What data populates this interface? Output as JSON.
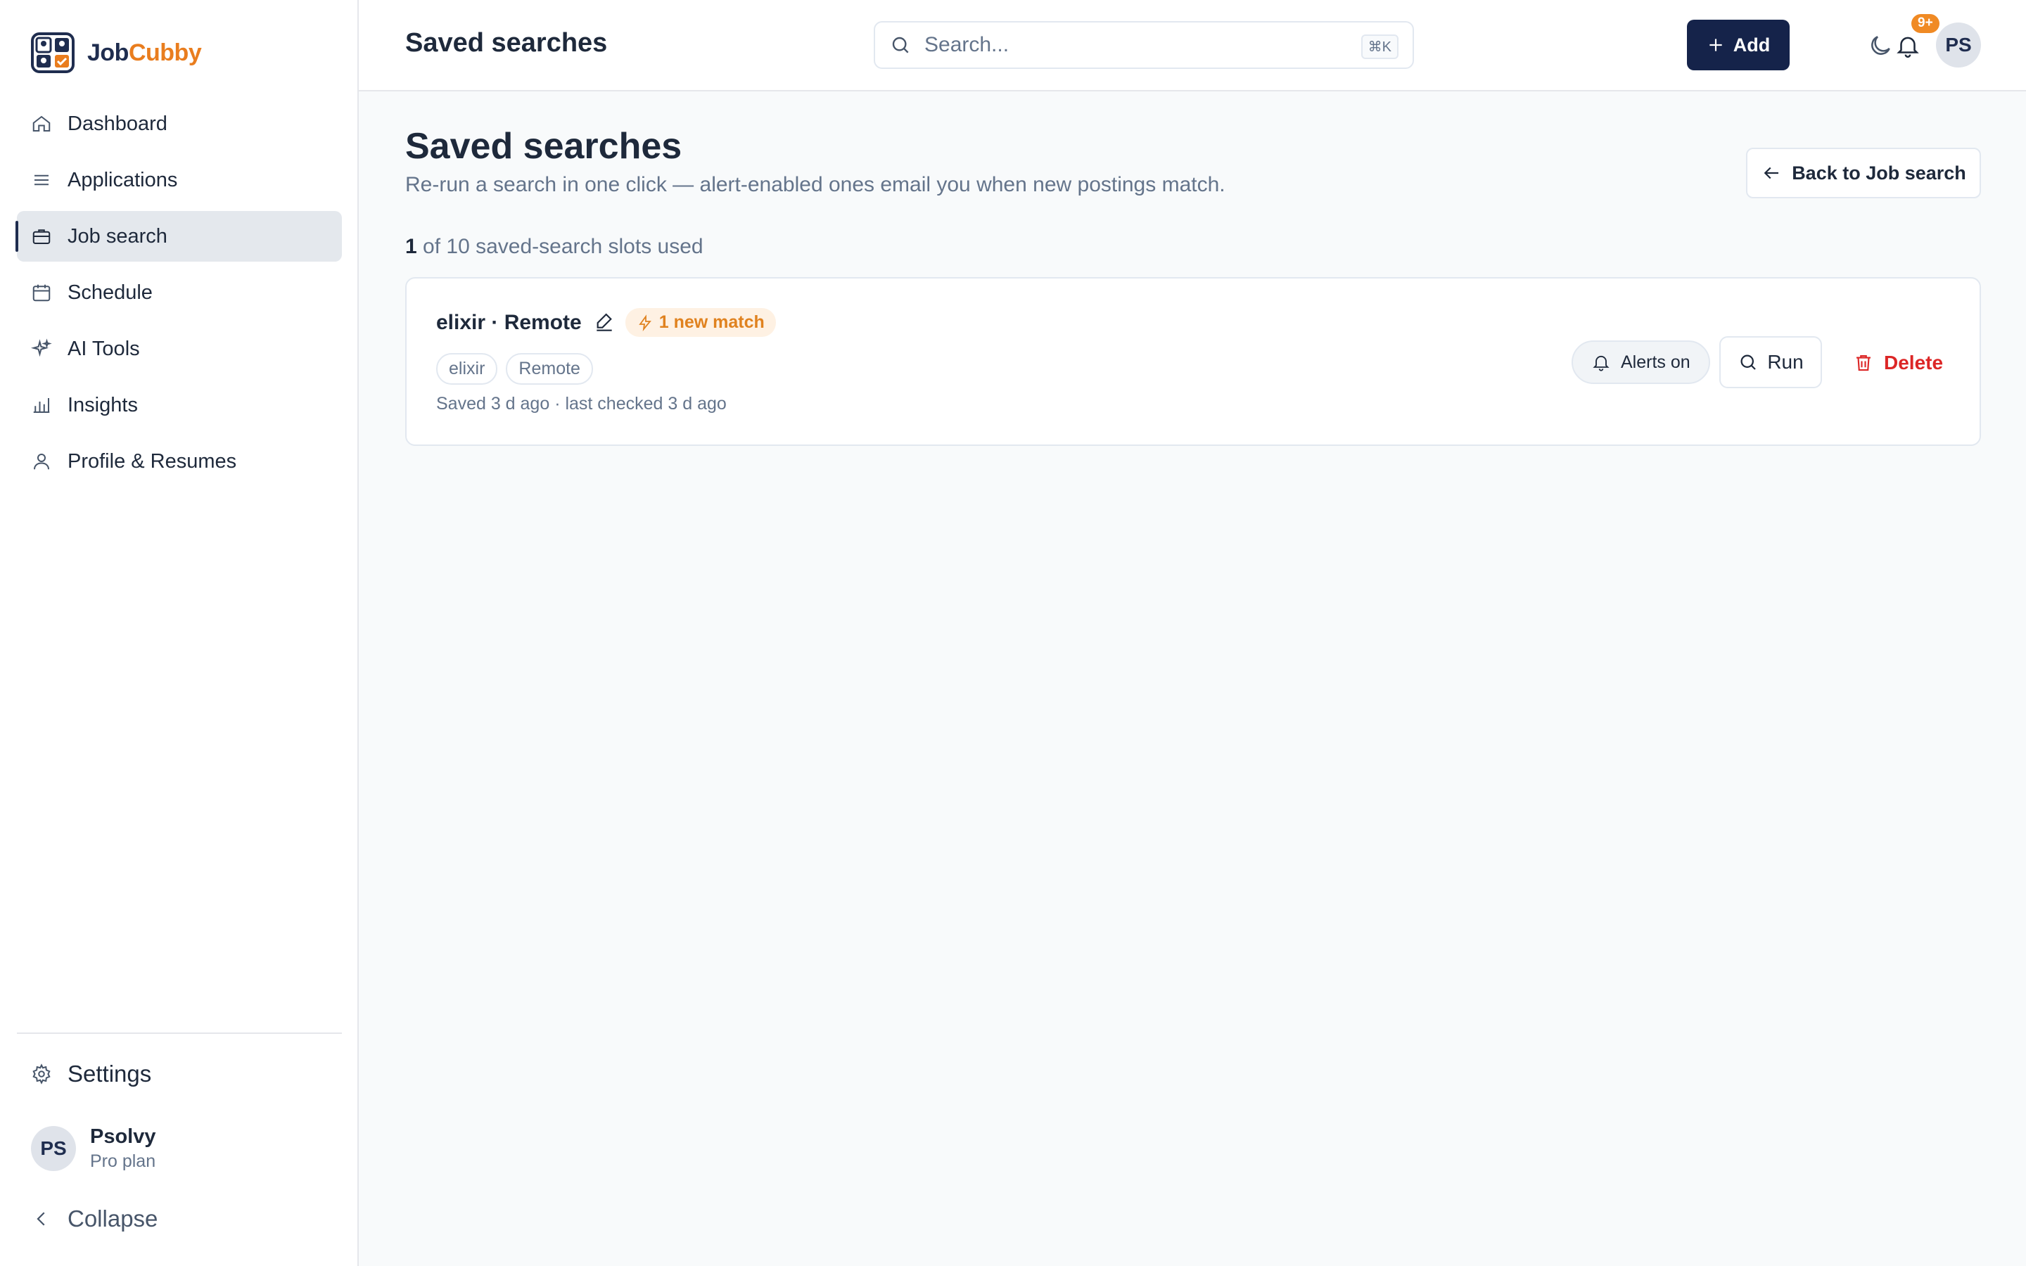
{
  "app": {
    "brand_part1": "Job",
    "brand_part2": "Cubby",
    "brand_color": "#1f2d4f",
    "accent_color": "#e97d1e"
  },
  "sidebar": {
    "items": [
      {
        "label": "Dashboard",
        "icon": "home-icon"
      },
      {
        "label": "Applications",
        "icon": "list-icon"
      },
      {
        "label": "Job search",
        "icon": "briefcase-icon",
        "active": true
      },
      {
        "label": "Schedule",
        "icon": "calendar-icon"
      },
      {
        "label": "AI Tools",
        "icon": "sparkles-icon"
      },
      {
        "label": "Insights",
        "icon": "bar-chart-icon"
      },
      {
        "label": "Profile & Resumes",
        "icon": "user-icon"
      }
    ],
    "settings_label": "Settings",
    "user": {
      "initials": "PS",
      "name": "Psolvy",
      "plan": "Pro plan"
    },
    "collapse_label": "Collapse"
  },
  "header": {
    "title": "Saved searches",
    "search_placeholder": "Search...",
    "search_shortcut": "⌘K",
    "add_label": "Add",
    "notification_badge": "9+",
    "avatar_initials": "PS"
  },
  "main": {
    "title": "Saved searches",
    "subtitle": "Re-run a search in one click — alert-enabled ones email you when new postings match.",
    "back_label": "Back to Job search",
    "slots_used": "1",
    "slots_text": "of 10 saved-search slots used",
    "saved_searches": [
      {
        "title": "elixir · Remote",
        "match_badge": "1 new match",
        "chips": [
          "elixir",
          "Remote"
        ],
        "meta": "Saved 3 d ago · last checked 3 d ago",
        "alerts_label": "Alerts on",
        "run_label": "Run",
        "delete_label": "Delete"
      }
    ]
  }
}
